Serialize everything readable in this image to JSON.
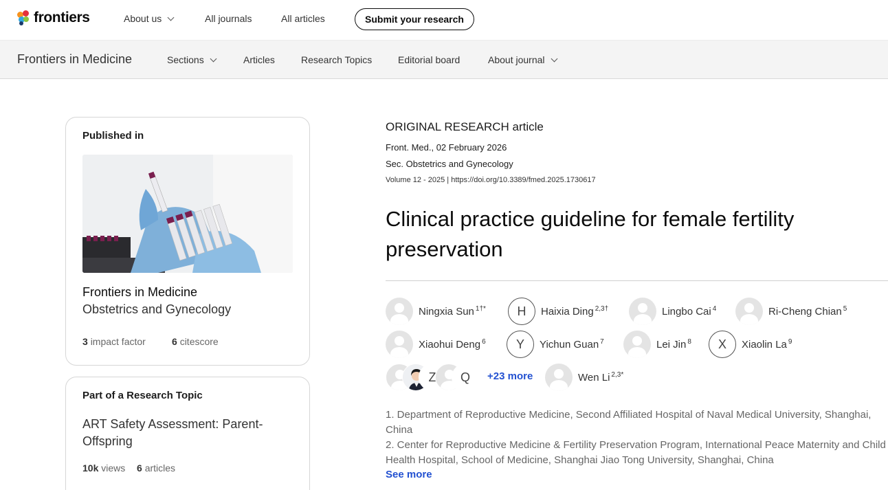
{
  "brand": {
    "name": "frontiers"
  },
  "topnav": {
    "items": [
      {
        "label": "About us",
        "dropdown": true
      },
      {
        "label": "All journals"
      },
      {
        "label": "All articles"
      }
    ],
    "submit_label": "Submit your research"
  },
  "journalnav": {
    "journal": "Frontiers in Medicine",
    "items": [
      {
        "label": "Sections",
        "dropdown": true
      },
      {
        "label": "Articles"
      },
      {
        "label": "Research Topics"
      },
      {
        "label": "Editorial board"
      },
      {
        "label": "About journal",
        "dropdown": true
      }
    ]
  },
  "published_in": {
    "label": "Published in",
    "journal": "Frontiers in Medicine",
    "section": "Obstetrics and Gynecology",
    "impact_factor_value": "3",
    "impact_factor_label": "impact factor",
    "citescore_value": "6",
    "citescore_label": "citescore"
  },
  "research_topic": {
    "label": "Part of a Research Topic",
    "title": "ART Safety Assessment: Parent-Offspring",
    "views_value": "10k",
    "views_label": "views",
    "articles_value": "6",
    "articles_label": "articles"
  },
  "article": {
    "type": "ORIGINAL RESEARCH article",
    "date_line": "Front. Med., 02 February 2026",
    "section_line": "Sec. Obstetrics and Gynecology",
    "volume_line": "Volume 12 - 2025 | https://doi.org/10.3389/fmed.2025.1730617",
    "title": "Clinical practice guideline for female fertility preservation"
  },
  "authors": [
    {
      "name": "Ningxia Sun",
      "sup": "1†*",
      "avatar": "default"
    },
    {
      "name": "Haixia Ding",
      "sup": "2,3†",
      "avatar": "H"
    },
    {
      "name": "Lingbo Cai",
      "sup": "4",
      "avatar": "default"
    },
    {
      "name": "Ri-Cheng Chian",
      "sup": "5",
      "avatar": "default"
    },
    {
      "name": "Xiaohui Deng",
      "sup": "6",
      "avatar": "default"
    },
    {
      "name": "Yichun Guan",
      "sup": "7",
      "avatar": "Y"
    },
    {
      "name": "Lei Jin",
      "sup": "8",
      "avatar": "default"
    },
    {
      "name": "Xiaolin La",
      "sup": "9",
      "avatar": "X"
    },
    {
      "name": "Wen Li",
      "sup": "2,3*",
      "avatar": "default"
    }
  ],
  "author_stack": {
    "letters": [
      "Z",
      "Q"
    ],
    "more_label": "+23 more"
  },
  "affiliations": {
    "lines": [
      "1. Department of Reproductive Medicine, Second Affiliated Hospital of Naval Medical University, Shanghai, China",
      "2. Center for Reproductive Medicine & Fertility Preservation Program, International Peace Maternity and Child Health Hospital, School of Medicine, Shanghai Jiao Tong University, Shanghai, China"
    ],
    "see_more": "See more"
  },
  "colors": {
    "link": "#2351d1",
    "text": "#0c0c0c",
    "muted": "#666666",
    "border": "#d6d6d6"
  }
}
